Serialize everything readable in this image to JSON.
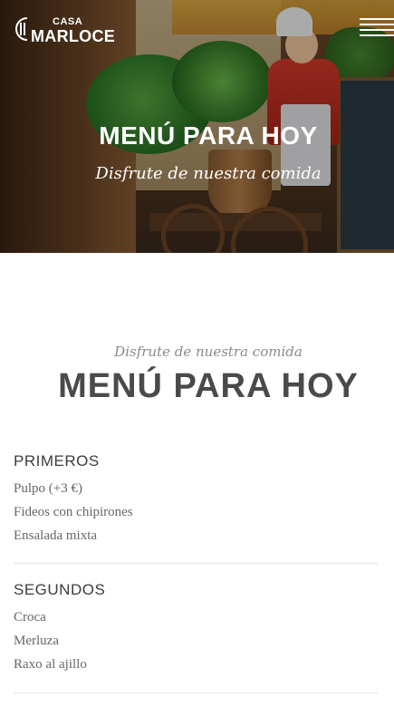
{
  "header": {
    "logo_small": "CASA",
    "logo_big": "MARLOCE"
  },
  "hero": {
    "title": "MENÚ PARA HOY",
    "subtitle": "Disfrute de nuestra comida"
  },
  "menu_section": {
    "subtitle": "Disfrute de nuestra comida",
    "title": "MENÚ PARA HOY",
    "courses": [
      {
        "heading": "PRIMEROS",
        "dishes": [
          "Pulpo (+3 €)",
          "Fideos con chipirones",
          "Ensalada mixta"
        ]
      },
      {
        "heading": "SEGUNDOS",
        "dishes": [
          "Croca",
          "Merluza",
          "Raxo al ajillo"
        ]
      }
    ]
  },
  "icons": {
    "logo": "spoon-fork-logo-icon",
    "menu": "hamburger-menu-icon"
  }
}
